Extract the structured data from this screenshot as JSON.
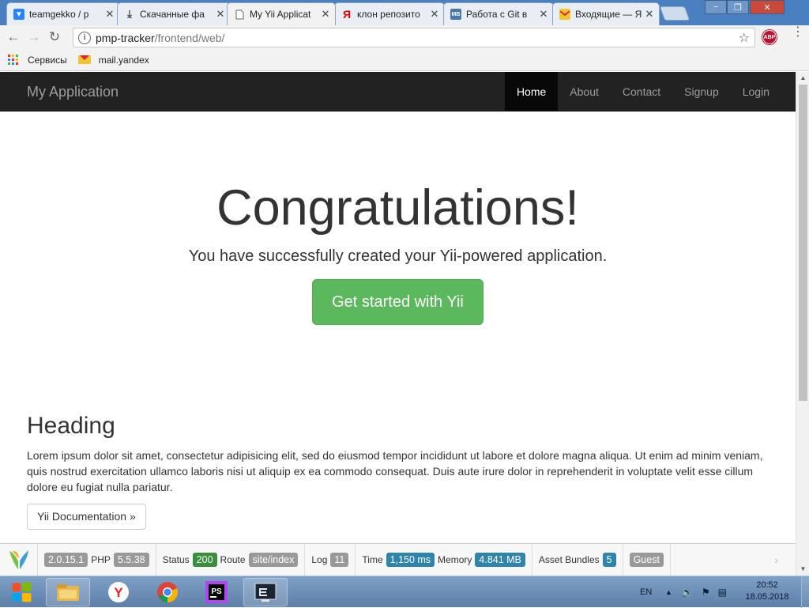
{
  "browser": {
    "tabs": [
      {
        "title": "teamgekko / p",
        "favicon": "bitbucket-icon",
        "active": false
      },
      {
        "title": "Скачанные фа",
        "favicon": "download-icon",
        "active": false
      },
      {
        "title": "My Yii Applicat",
        "favicon": "page-icon",
        "active": true
      },
      {
        "title": "клон репозито",
        "favicon": "yandex-icon",
        "active": false
      },
      {
        "title": "Работа с Git в",
        "favicon": "mb-icon",
        "active": false
      },
      {
        "title": "Входящие — Я",
        "favicon": "mail-icon",
        "active": false
      }
    ],
    "url_host": "pmp-tracker",
    "url_path": "/frontend/web/",
    "abp_label": "ABP",
    "bookmarks": [
      {
        "label": "Сервисы",
        "icon": "apps-icon"
      },
      {
        "label": "mail.yandex",
        "icon": "mail-icon"
      }
    ]
  },
  "app": {
    "brand": "My Application",
    "nav": [
      {
        "label": "Home",
        "active": true
      },
      {
        "label": "About",
        "active": false
      },
      {
        "label": "Contact",
        "active": false
      },
      {
        "label": "Signup",
        "active": false
      },
      {
        "label": "Login",
        "active": false
      }
    ],
    "jumbotron": {
      "title": "Congratulations!",
      "lead": "You have successfully created your Yii-powered application.",
      "button": "Get started with Yii"
    },
    "section": {
      "heading": "Heading",
      "body": "Lorem ipsum dolor sit amet, consectetur adipisicing elit, sed do eiusmod tempor incididunt ut labore et dolore magna aliqua. Ut enim ad minim veniam, quis nostrud exercitation ullamco laboris nisi ut aliquip ex ea commodo consequat. Duis aute irure dolor in reprehenderit in voluptate velit esse cillum dolore eu fugiat nulla pariatur.",
      "button": "Yii Documentation »"
    }
  },
  "debug": {
    "yii_version": "2.0.15.1",
    "php_label": "PHP",
    "php_version": "5.5.38",
    "status_label": "Status",
    "status": "200",
    "route_label": "Route",
    "route": "site/index",
    "log_label": "Log",
    "log_count": "11",
    "time_label": "Time",
    "time": "1,150 ms",
    "memory_label": "Memory",
    "memory": "4.841 MB",
    "assets_label": "Asset Bundles",
    "assets_count": "5",
    "user": "Guest"
  },
  "taskbar": {
    "apps": [
      "file-explorer-icon",
      "yandex-browser-icon",
      "chrome-icon",
      "phpstorm-icon",
      "terminal-icon"
    ],
    "language": "EN",
    "time": "20:52",
    "date": "18.05.2018"
  },
  "colors": {
    "success": "#5cb85c",
    "navbar": "#222222",
    "label_blue": "#2f84ad",
    "label_green": "#3a8d3a"
  }
}
